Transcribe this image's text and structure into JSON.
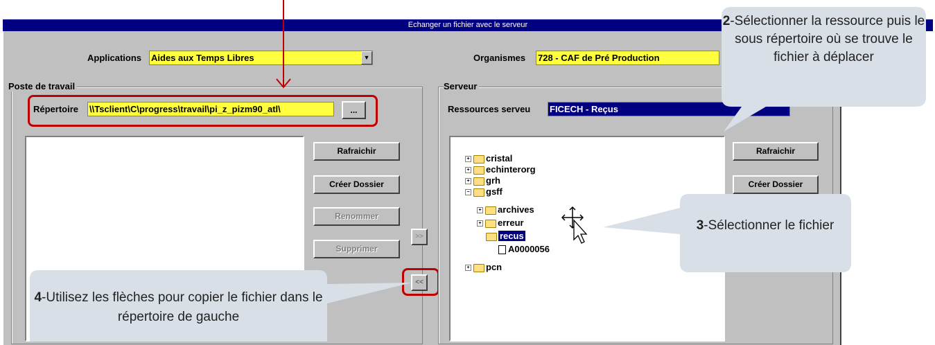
{
  "window": {
    "title": "Echanger un fichier avec le serveur"
  },
  "applications": {
    "label": "Applications",
    "value": "Aides aux Temps Libres"
  },
  "organismes": {
    "label": "Organismes",
    "value": "728 - CAF de Pré Production"
  },
  "poste": {
    "group_title": "Poste de travail",
    "dir_label": "Répertoire",
    "dir_value": "\\\\Tsclient\\C\\progress\\travail\\pi_z_pizm90_atl\\",
    "browse_label": "...",
    "buttons": {
      "refresh": "Rafraichir",
      "create": "Créer Dossier",
      "rename": "Renommer",
      "delete": "Supprimer"
    }
  },
  "serveur": {
    "group_title": "Serveur",
    "res_label": "Ressources serveu",
    "res_value": "FICECH - Reçus",
    "buttons": {
      "refresh": "Rafraichir",
      "create": "Créer Dossier"
    },
    "tree": {
      "cristal": "cristal",
      "echinterorg": "echinterorg",
      "grh": "grh",
      "gsff": "gsff",
      "archives": "archives",
      "erreur": "erreur",
      "recus": "recus",
      "file": "A0000056",
      "pcn": "pcn"
    }
  },
  "transfer": {
    "right": ">>",
    "left": "<<"
  },
  "callouts": {
    "c2": {
      "num": "2",
      "text": "-Sélectionner la ressource puis le sous répertoire où se trouve le fichier à déplacer"
    },
    "c3": {
      "num": "3",
      "text": "-Sélectionner le fichier"
    },
    "c4": {
      "num": "4",
      "text": "-Utilisez les flèches pour copier le fichier dans le répertoire de gauche"
    }
  },
  "colors": {
    "titlebar": "#000080",
    "field": "#ffff40",
    "highlight": "#c00000",
    "callout": "#d9dfe6"
  }
}
